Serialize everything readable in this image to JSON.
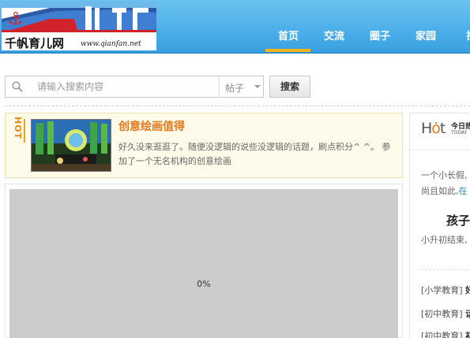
{
  "header": {
    "brand": "千帆育儿网",
    "url": "www.qianfan.net",
    "nav": [
      "首页",
      "交流",
      "圈子",
      "家园",
      "播"
    ],
    "active_index": 0
  },
  "search": {
    "placeholder": "请输入搜索内容",
    "type_label": "帖子",
    "button_label": "搜索"
  },
  "hot": {
    "tag": "HOT",
    "title": "创意绘画值得",
    "desc": "好久没来逛逛了。随便没逻辑的说些没逻辑的话题，刷点积分^ ^。 参加了一个无名机构的创意绘画"
  },
  "main": {
    "progress": "0%"
  },
  "side": {
    "hot_label": "Hot",
    "today_cn": "今日热",
    "today_en": "TODAY",
    "line1": "一个小长假,",
    "line2a": "尚且如此,",
    "line2b": "在",
    "headline": "孩子",
    "sub": "小升初结束,",
    "cats": [
      {
        "tag": "[小学教育]",
        "text": "好"
      },
      {
        "tag": "[初中教育]",
        "text": "话"
      },
      {
        "tag": "[初中教育]",
        "text": "初"
      }
    ]
  },
  "colors": {
    "header_blue": "#4aaee9",
    "nav_active": "#f2b31b",
    "hot_orange": "#e4781a"
  }
}
